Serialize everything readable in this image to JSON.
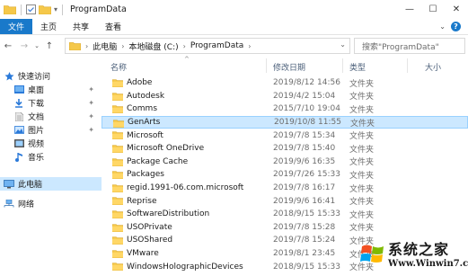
{
  "window": {
    "title": "ProgramData",
    "controls": {
      "minimize": "—",
      "maximize": "☐",
      "close": "✕"
    }
  },
  "ribbon": {
    "tabs": [
      {
        "label": "文件",
        "active": true
      },
      {
        "label": "主页",
        "active": false
      },
      {
        "label": "共享",
        "active": false
      },
      {
        "label": "查看",
        "active": false
      }
    ],
    "help": "?"
  },
  "address": {
    "path": [
      "此电脑",
      "本地磁盘 (C:)",
      "ProgramData"
    ]
  },
  "search": {
    "placeholder": "搜索\"ProgramData\""
  },
  "nav": {
    "items": [
      {
        "label": "快速访问",
        "icon": "star-icon",
        "pinned": false
      },
      {
        "label": "桌面",
        "icon": "desktop-icon",
        "pinned": true
      },
      {
        "label": "下载",
        "icon": "download-icon",
        "pinned": true
      },
      {
        "label": "文档",
        "icon": "document-icon",
        "pinned": true
      },
      {
        "label": "图片",
        "icon": "picture-icon",
        "pinned": true
      },
      {
        "label": "视频",
        "icon": "video-icon",
        "pinned": false
      },
      {
        "label": "音乐",
        "icon": "music-icon",
        "pinned": false
      },
      {
        "label": "此电脑",
        "icon": "computer-icon",
        "pinned": false,
        "selected": true
      },
      {
        "label": "网络",
        "icon": "network-icon",
        "pinned": false
      }
    ]
  },
  "columns": {
    "name": "名称",
    "date": "修改日期",
    "type": "类型",
    "size": "大小"
  },
  "files": [
    {
      "name": "Adobe",
      "date": "2019/8/12 14:56",
      "type": "文件夹"
    },
    {
      "name": "Autodesk",
      "date": "2019/4/2 15:04",
      "type": "文件夹"
    },
    {
      "name": "Comms",
      "date": "2015/7/10 19:04",
      "type": "文件夹"
    },
    {
      "name": "GenArts",
      "date": "2019/10/8 11:55",
      "type": "文件夹",
      "selected": true
    },
    {
      "name": "Microsoft",
      "date": "2019/7/8 15:34",
      "type": "文件夹"
    },
    {
      "name": "Microsoft OneDrive",
      "date": "2019/7/8 15:40",
      "type": "文件夹"
    },
    {
      "name": "Package Cache",
      "date": "2019/9/6 16:35",
      "type": "文件夹"
    },
    {
      "name": "Packages",
      "date": "2019/7/26 15:33",
      "type": "文件夹"
    },
    {
      "name": "regid.1991-06.com.microsoft",
      "date": "2019/7/8 16:17",
      "type": "文件夹"
    },
    {
      "name": "Reprise",
      "date": "2019/9/6 16:41",
      "type": "文件夹"
    },
    {
      "name": "SoftwareDistribution",
      "date": "2018/9/15 15:33",
      "type": "文件夹"
    },
    {
      "name": "USOPrivate",
      "date": "2019/7/8 15:28",
      "type": "文件夹"
    },
    {
      "name": "USOShared",
      "date": "2019/7/8 15:24",
      "type": "文件夹"
    },
    {
      "name": "VMware",
      "date": "2019/8/1 23:45",
      "type": "文件夹"
    },
    {
      "name": "WindowsHolographicDevices",
      "date": "2018/9/15 15:33",
      "type": "文件夹"
    }
  ],
  "watermark": {
    "brand": "系统之家",
    "url": "Www.Winwin7.com"
  },
  "colors": {
    "accent": "#1979ca",
    "selection": "#cce8ff",
    "folder": "#f5c84a"
  }
}
